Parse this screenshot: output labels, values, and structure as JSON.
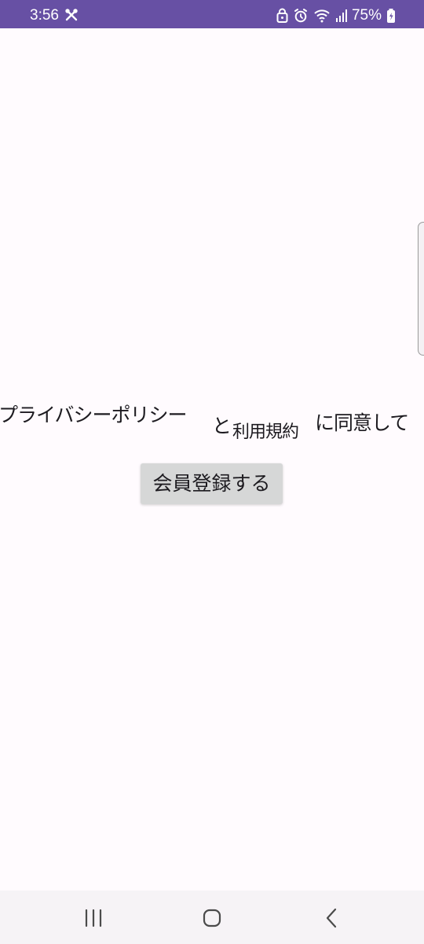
{
  "status_bar": {
    "time": "3:56",
    "battery": "75%",
    "icons": [
      "tools-icon",
      "lock-icon",
      "alarm-icon",
      "wifi-icon",
      "signal-icon",
      "battery-icon"
    ],
    "background": "#6750a4"
  },
  "consent": {
    "privacy_policy": "プライバシーポリシー",
    "and": "と",
    "terms": "利用規約",
    "agree": "に同意して"
  },
  "register_button": {
    "label": "会員登録する"
  },
  "navigation": {
    "buttons": [
      "recent-apps-icon",
      "home-icon",
      "back-icon"
    ]
  }
}
